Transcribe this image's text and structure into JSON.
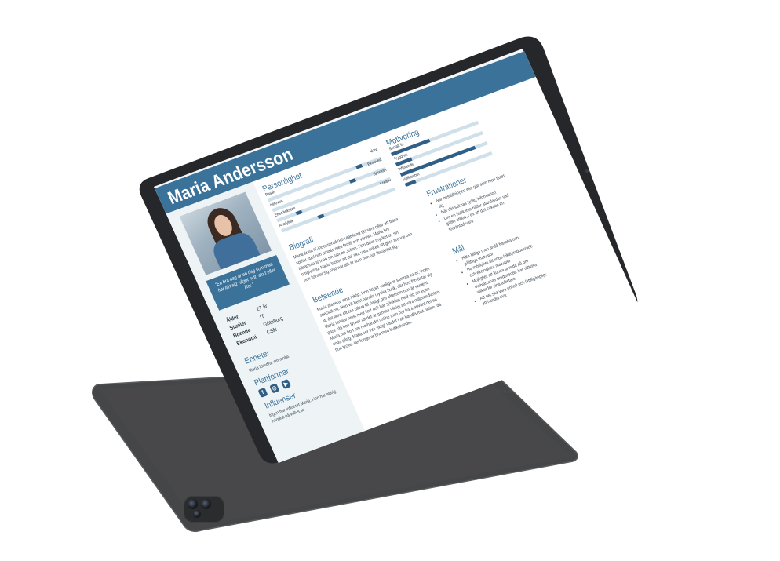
{
  "persona": {
    "name": "Maria Andersson",
    "quote": "\"En bra dag är en dag som man har lärt sig något nytt, stort eller litet.\"",
    "facts": [
      {
        "key": "Ålder",
        "value": "27 år"
      },
      {
        "key": "Studier",
        "value": "IT"
      },
      {
        "key": "Boende",
        "value": "Göteborg"
      },
      {
        "key": "Ekonomi",
        "value": "CSN"
      }
    ]
  },
  "sections": {
    "personality": "Personlighet",
    "motivation": "Motivering",
    "frustrations": "Frustrationer",
    "goals": "Mål",
    "bio": "Biografi",
    "behavior": "Beteende",
    "devices": "Enheter",
    "platforms": "Plattformar",
    "influencers": "Influenser"
  },
  "personality": [
    {
      "left": "Passiv",
      "right": "Aktiv",
      "value": 0.82
    },
    {
      "left": "Introvert",
      "right": "Extrovert",
      "value": 0.72
    },
    {
      "left": "Eftertänksam",
      "right": "Spontan",
      "value": 0.18
    },
    {
      "left": "Analytisk",
      "right": "Kreativ",
      "value": 0.34
    }
  ],
  "motivation": [
    {
      "label": "Socialt liv",
      "value": 0.44
    },
    {
      "label": "Trygghet",
      "value": 0.18
    },
    {
      "label": "Inflytande",
      "value": 0.86
    },
    {
      "label": "Nyfikenhet",
      "value": 0.12
    }
  ],
  "frustrations": [
    "När beställningen inte går som man tänkt sig",
    "När det saknas tydlig information",
    "Om en butik inte håller standarden vad gäller utbud, t ex att det saknas en förväntad vara"
  ],
  "goals": [
    "Hitta billiga men ändå fräscha och pålitliga matvaror",
    "Ha möjlighet att köpa lokalproducerade och ekologiska matvaror",
    "Möjlighet att kunna ta reda på om matvarornas producenter har rättvisa villkor för sina arbetare",
    "Att det ska vara enkelt och lättillgängligt att handla mat"
  ],
  "bio_text": "Maria är en IT-intresserad och utåtriktad tjej som gillar att träna, spelar spel och umgås med familj och vänner. Maria bor tillsammans med sin sambo Johan. Hon drivs mycket av sin omgivning. Maria tycker att det ska vara enkelt att göra bra val och hon känner sig nöjd när allt är som hon har förväntat sig.",
  "behavior_text": "Maria planerar sina inköp. Hon köper vanligtvis samma varor, ingen specialkost. Hon vill helst handla i fysisk butik, där hon förväntar sig att det finns ett bra utbud till rimligt pris eftersom hon är student. Maria betalar helst med kort och har sjävklart med sig sin egen påse, då hon tycker att det är ganska viktigt att vara miljömedveten. Maria har hört om mathandel online men har bara använt det en enda gång. Maria ser inte riktigt värdet i att handla mat online, då hon tycker det fungerar bra med butikshandel.",
  "devices_text": "Maria föredrar sin mobil.",
  "influencers_text": "Ingen har influerat Maria. Hon har aldrig handlat på willys.se.",
  "platforms": [
    {
      "icon": "facebook-icon",
      "glyph": "f"
    },
    {
      "icon": "instagram-icon",
      "glyph": "◎"
    },
    {
      "icon": "youtube-icon",
      "glyph": "▶"
    }
  ]
}
